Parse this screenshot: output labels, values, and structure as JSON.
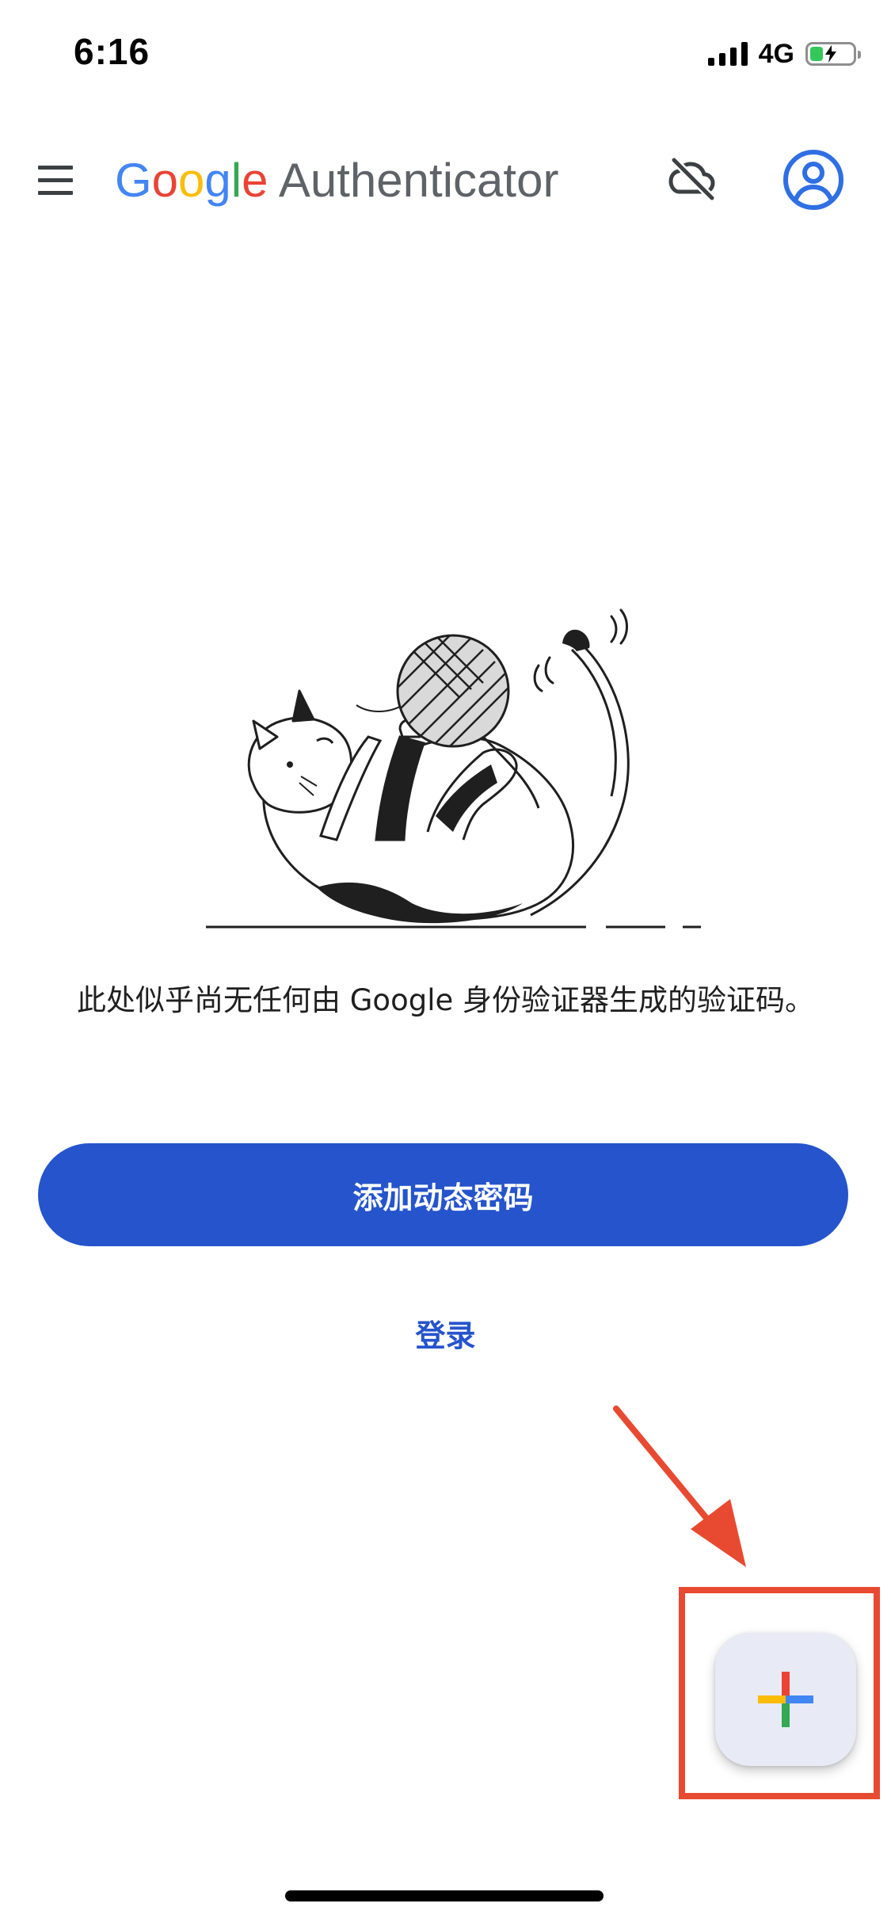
{
  "status_bar": {
    "time": "6:16",
    "network": "4G",
    "signal_bars": 4,
    "battery_charging": true,
    "battery_level": 0.3
  },
  "app_bar": {
    "title_brand_letters": [
      "G",
      "o",
      "o",
      "g",
      "l",
      "e"
    ],
    "title_product": "Authenticator",
    "icons": [
      "menu-icon",
      "cloud-off-icon",
      "account-circle-icon"
    ]
  },
  "empty_state": {
    "message": "此处似乎尚无任何由 Google 身份验证器生成的验证码。"
  },
  "actions": {
    "add_code_label": "添加动态密码",
    "sign_in_label": "登录"
  },
  "fab": {
    "icon": "plus-icon"
  },
  "colors": {
    "primary": "#2554cc",
    "google_blue": "#4285F4",
    "google_red": "#EA4335",
    "google_yellow": "#FBBC05",
    "google_green": "#34A853",
    "annotation_red": "#e84a31",
    "fab_background": "#e8eaf6"
  }
}
